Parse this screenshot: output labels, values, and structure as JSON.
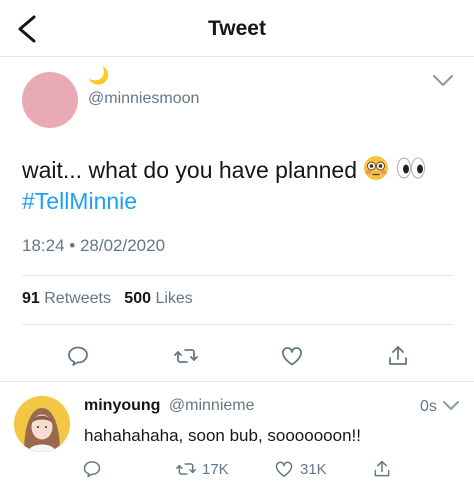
{
  "header": {
    "title": "Tweet"
  },
  "tweet": {
    "moon_emoji": "🌙",
    "handle": "@minniesmoon",
    "text": "wait... what do you have planned",
    "hashtag": "#TellMinnie",
    "timestamp": "18:24 • 28/02/2020",
    "retweets_count": "91",
    "retweets_label": "Retweets",
    "likes_count": "500",
    "likes_label": "Likes"
  },
  "reply": {
    "name": "minyoung",
    "handle": "@minnieme",
    "time": "0s",
    "text": "hahahahaha, soon bub, sooooooon!!",
    "retweet_count": "17K",
    "like_count": "31K"
  },
  "colors": {
    "accent": "#1da1f2",
    "muted": "#657786",
    "divider": "#e1e8ed",
    "avatar_pink": "#e8aab5"
  }
}
